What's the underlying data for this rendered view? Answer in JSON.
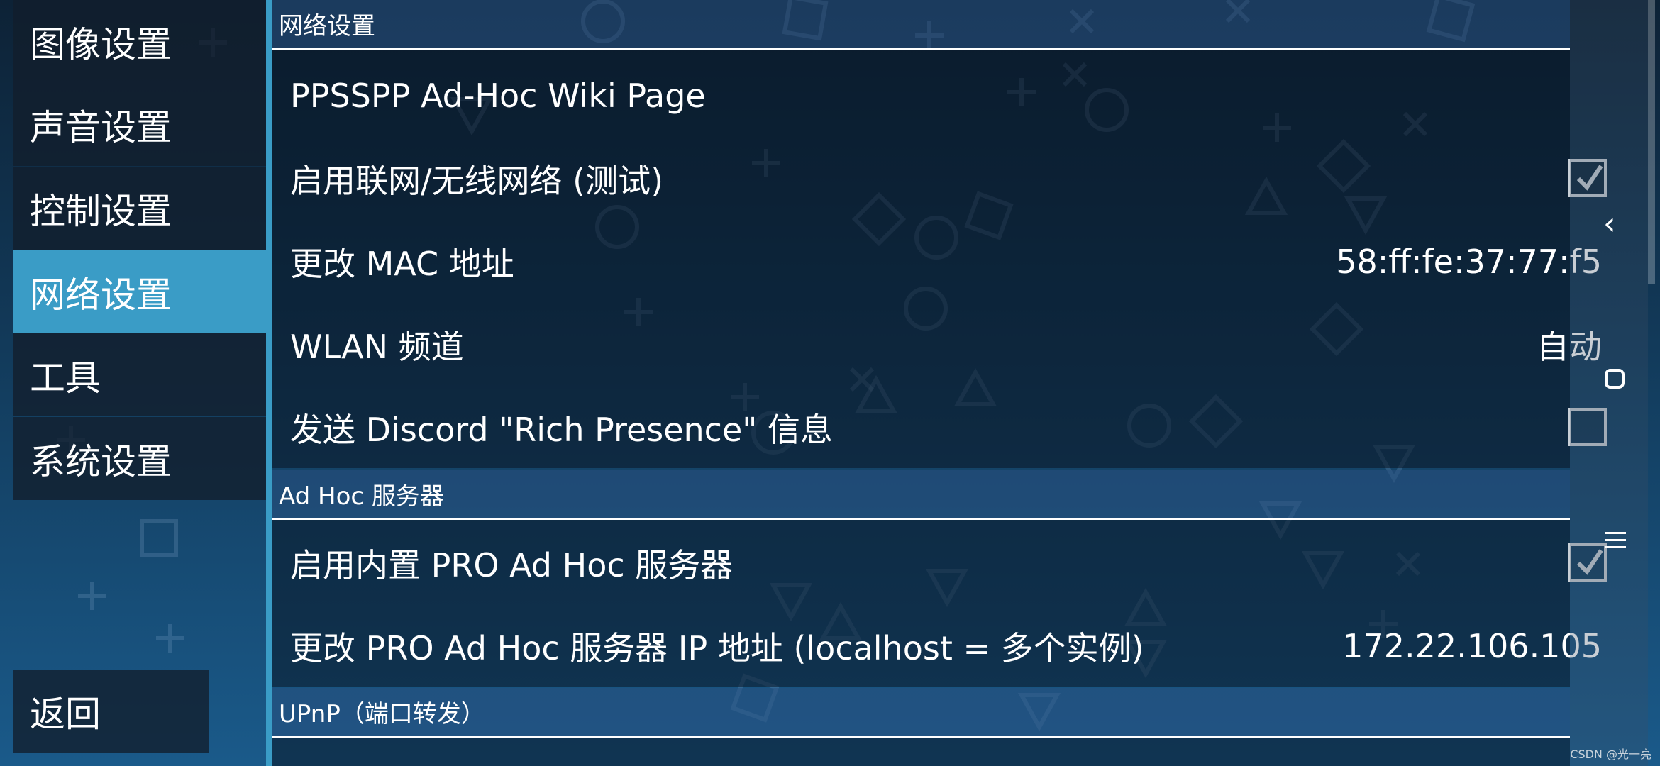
{
  "sidebar": {
    "items": [
      {
        "label": "图像设置"
      },
      {
        "label": "声音设置"
      },
      {
        "label": "控制设置"
      },
      {
        "label": "网络设置",
        "active": true
      },
      {
        "label": "工具"
      },
      {
        "label": "系统设置"
      }
    ],
    "back_label": "返回"
  },
  "sections": {
    "network": {
      "title": "网络设置",
      "rows": {
        "wiki": {
          "label": "PPSSPP Ad-Hoc Wiki Page"
        },
        "enable_network": {
          "label": "启用联网/无线网络 (测试)",
          "checked": true
        },
        "mac": {
          "label": "更改 MAC 地址",
          "value": "58:ff:fe:37:77:f5"
        },
        "wlan": {
          "label": "WLAN 频道",
          "value": "自动"
        },
        "discord": {
          "label": "发送 Discord \"Rich Presence\" 信息",
          "checked": false
        }
      }
    },
    "adhoc": {
      "title": "Ad Hoc 服务器",
      "rows": {
        "builtin_server": {
          "label": "启用内置 PRO Ad Hoc 服务器",
          "checked": true
        },
        "server_ip": {
          "label": "更改 PRO Ad Hoc 服务器 IP 地址 (localhost = 多个实例)",
          "value": "172.22.106.105"
        }
      }
    },
    "upnp": {
      "title": "UPnP（端口转发）"
    }
  },
  "watermark": "CSDN @光一亮",
  "colors": {
    "accent": "#3a9cc6",
    "background_top": "#0d2236",
    "background_bottom": "#1a5a8a"
  }
}
